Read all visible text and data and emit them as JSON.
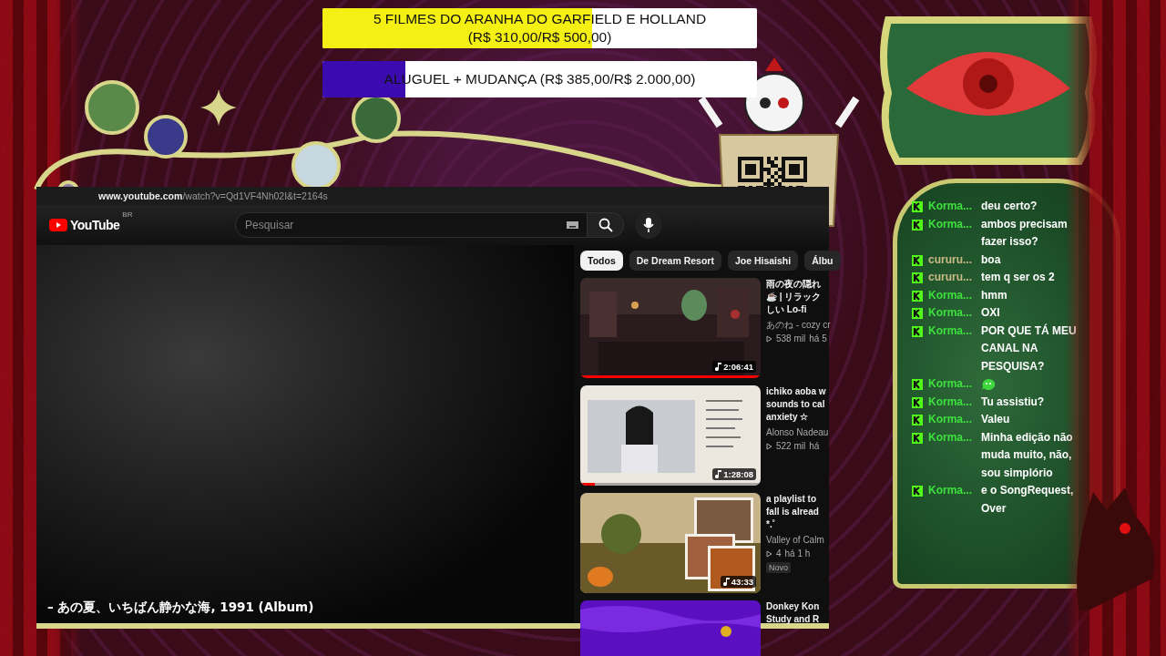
{
  "goals": [
    {
      "lines": [
        "5 FILMES DO ARANHA DO GARFIELD E HOLLAND",
        "(R$ 310,00/R$ 500,00)"
      ],
      "level": 0.62,
      "color": "#f5f014"
    },
    {
      "lines": [
        "ALUGUEL + MUDANÇA (R$ 385,00/R$ 2.000,00)"
      ],
      "level": 0.19,
      "color": "#3b0bb0"
    }
  ],
  "browser": {
    "url_host": "www.youtube.com",
    "url_path": "/watch?v=Qd1VF4Nh02I&t=2164s",
    "logo": "YouTube",
    "region": "BR",
    "search": {
      "placeholder": "Pesquisar"
    }
  },
  "player": {
    "caption": "– あの夏、いちばん静かな海, 1991 (Album)"
  },
  "chips": [
    {
      "label": "Todos",
      "selected": true
    },
    {
      "label": "De Dream Resort",
      "selected": false
    },
    {
      "label": "Joe Hisaishi",
      "selected": false
    },
    {
      "label": "Álbu",
      "selected": false
    }
  ],
  "videos": [
    {
      "title_lines": [
        "雨の夜の隠れ",
        "☕ | リラック",
        "しい Lo-fi"
      ],
      "channel": "あのね - cozy cr",
      "views": "538 mil",
      "age": "há 5",
      "duration": "2:06:41",
      "level": 1.0
    },
    {
      "title_lines": [
        "ichiko aoba w",
        "sounds to cal",
        "anxiety ☆"
      ],
      "channel": "Alonso Nadeau",
      "views": "522 mil",
      "age": "há",
      "duration": "1:28:08",
      "level": 0.08
    },
    {
      "title_lines": [
        "a playlist to",
        "fall is alread",
        "*.˚"
      ],
      "channel": "Valley of Calm",
      "views": "4",
      "age": "há 1 h",
      "duration": "43:33",
      "badge": "Novo"
    },
    {
      "title_lines": [
        "Donkey Kon",
        "Study and R"
      ]
    }
  ],
  "chat": [
    {
      "user": "Korma...",
      "color": "#3ee03e",
      "kind": "text",
      "text": "deu certo?"
    },
    {
      "user": "Korma...",
      "color": "#3ee03e",
      "kind": "text",
      "text": "ambos precisam fazer isso?"
    },
    {
      "user": "cururu...",
      "color": "#c9bb85",
      "kind": "text",
      "text": "boa"
    },
    {
      "user": "cururu...",
      "color": "#c9bb85",
      "kind": "text",
      "text": "tem q ser os 2"
    },
    {
      "user": "Korma...",
      "color": "#3ee03e",
      "kind": "text",
      "text": "hmm"
    },
    {
      "user": "Korma...",
      "color": "#3ee03e",
      "kind": "text",
      "text": "OXI"
    },
    {
      "user": "Korma...",
      "color": "#3ee03e",
      "kind": "text",
      "text": "POR QUE TÁ MEU CANAL NA PESQUISA?"
    },
    {
      "user": "Korma...",
      "color": "#3ee03e",
      "kind": "emote"
    },
    {
      "user": "Korma...",
      "color": "#3ee03e",
      "kind": "text",
      "text": "Tu assistiu?"
    },
    {
      "user": "Korma...",
      "color": "#3ee03e",
      "kind": "text",
      "text": "Valeu"
    },
    {
      "user": "Korma...",
      "color": "#3ee03e",
      "kind": "text",
      "text": "Minha edição não muda muito, não, sou simplório"
    },
    {
      "user": "Korma...",
      "color": "#3ee03e",
      "kind": "text",
      "text": "e o SongRequest, Over"
    }
  ]
}
